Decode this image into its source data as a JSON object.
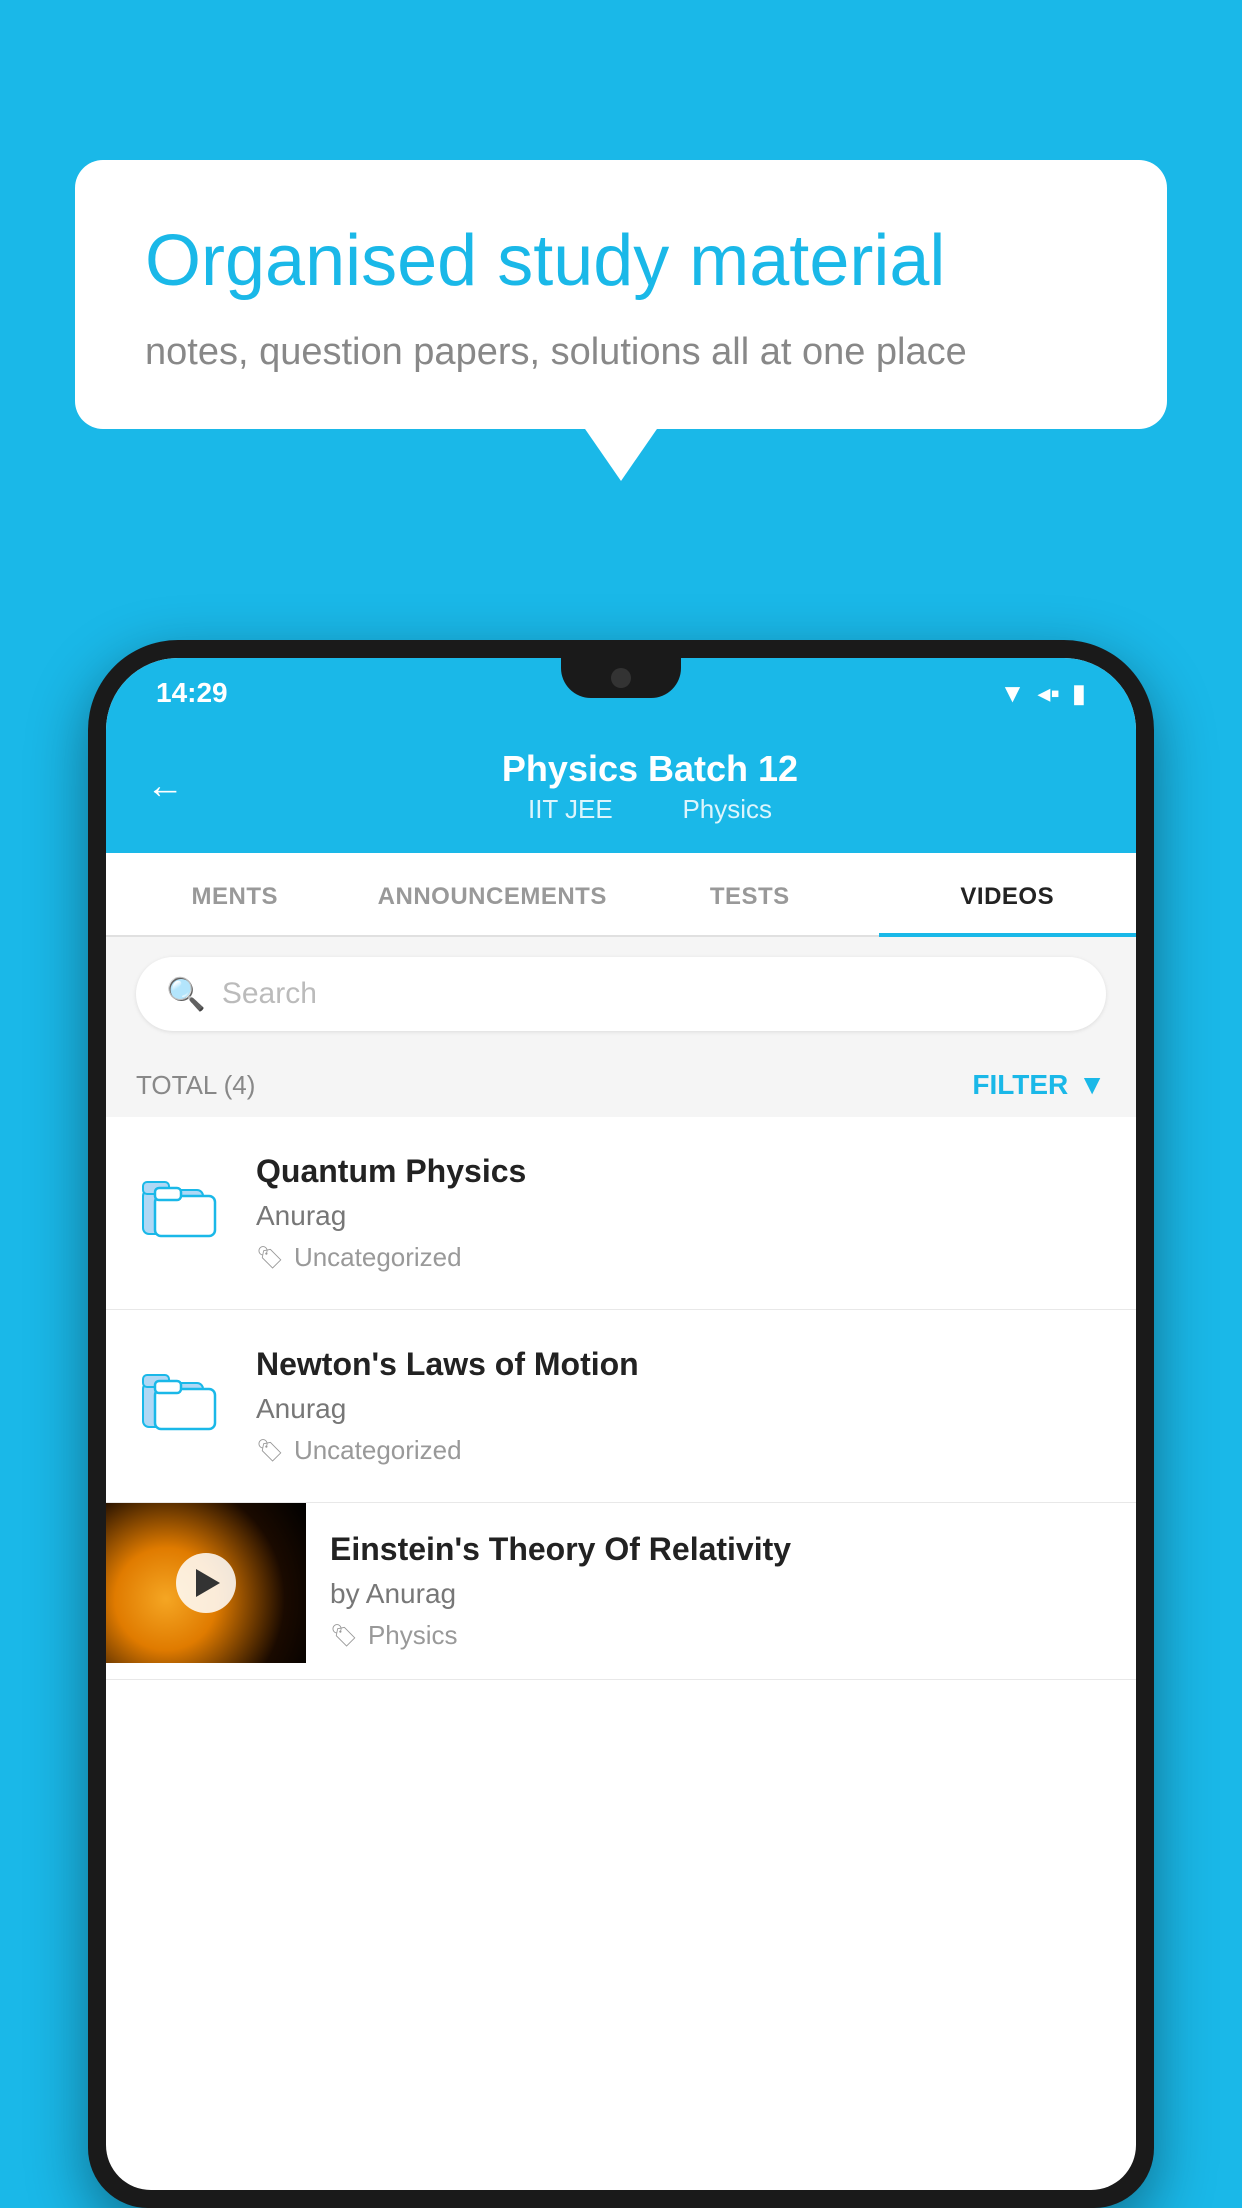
{
  "background": {
    "color": "#1ab8e8"
  },
  "speech_bubble": {
    "title": "Organised study material",
    "subtitle": "notes, question papers, solutions all at one place"
  },
  "phone": {
    "status_bar": {
      "time": "14:29",
      "icons": [
        "wifi",
        "signal",
        "battery"
      ]
    },
    "nav": {
      "back_label": "←",
      "title": "Physics Batch 12",
      "subtitle_part1": "IIT JEE",
      "subtitle_part2": "Physics"
    },
    "tabs": [
      {
        "label": "MENTS",
        "active": false
      },
      {
        "label": "ANNOUNCEMENTS",
        "active": false
      },
      {
        "label": "TESTS",
        "active": false
      },
      {
        "label": "VIDEOS",
        "active": true
      }
    ],
    "search": {
      "placeholder": "Search"
    },
    "filter": {
      "total_label": "TOTAL (4)",
      "filter_label": "FILTER"
    },
    "videos": [
      {
        "title": "Quantum Physics",
        "author": "Anurag",
        "tag": "Uncategorized",
        "type": "folder"
      },
      {
        "title": "Newton's Laws of Motion",
        "author": "Anurag",
        "tag": "Uncategorized",
        "type": "folder"
      },
      {
        "title": "Einstein's Theory Of Relativity",
        "author": "by Anurag",
        "tag": "Physics",
        "type": "video"
      }
    ]
  }
}
